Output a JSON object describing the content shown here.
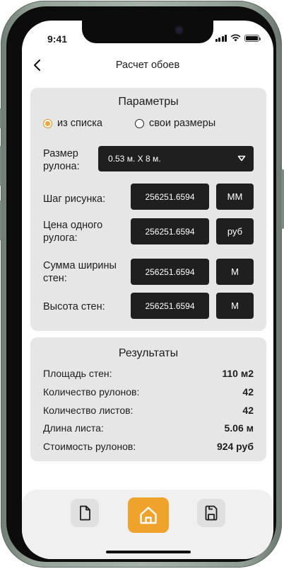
{
  "status_bar": {
    "time": "9:41"
  },
  "header": {
    "title": "Расчет обоев"
  },
  "parameters": {
    "heading": "Параметры",
    "radio_options": [
      {
        "label": "из списка",
        "selected": true
      },
      {
        "label": "свои размеры",
        "selected": false
      }
    ],
    "roll_size": {
      "label_line1": "Размер",
      "label_line2": "рулона:",
      "value": "0.53 м. Х 8 м."
    },
    "pattern_step": {
      "label": "Шаг рисунка:",
      "value": "256251.6594",
      "unit": "ММ"
    },
    "roll_price": {
      "label_line1": "Цена одного",
      "label_line2": "рулога:",
      "value": "256251.6594",
      "unit": "руб"
    },
    "wall_width_sum": {
      "label_line1": "Сумма ширины",
      "label_line2": "стен:",
      "value": "256251.6594",
      "unit": "М"
    },
    "wall_height": {
      "label": "Высота стен:",
      "value": "256251.6594",
      "unit": "М"
    }
  },
  "results": {
    "heading": "Результаты",
    "rows": [
      {
        "label": "Площадь стен:",
        "value": "110 м2"
      },
      {
        "label": "Количество рулонов:",
        "value": "42"
      },
      {
        "label": "Количество листов:",
        "value": "42"
      },
      {
        "label": "Длина листа:",
        "value": "5.06 м"
      },
      {
        "label": "Стоимость рулонов:",
        "value": "924 руб"
      }
    ]
  },
  "tabbar": {
    "items": [
      {
        "icon": "document-icon",
        "active": false
      },
      {
        "icon": "home-icon",
        "active": true
      },
      {
        "icon": "save-icon",
        "active": false
      }
    ]
  },
  "colors": {
    "accent": "#f0a32a",
    "card": "#e6e6e6",
    "field": "#1f1f1f",
    "frame": "#95a398"
  }
}
